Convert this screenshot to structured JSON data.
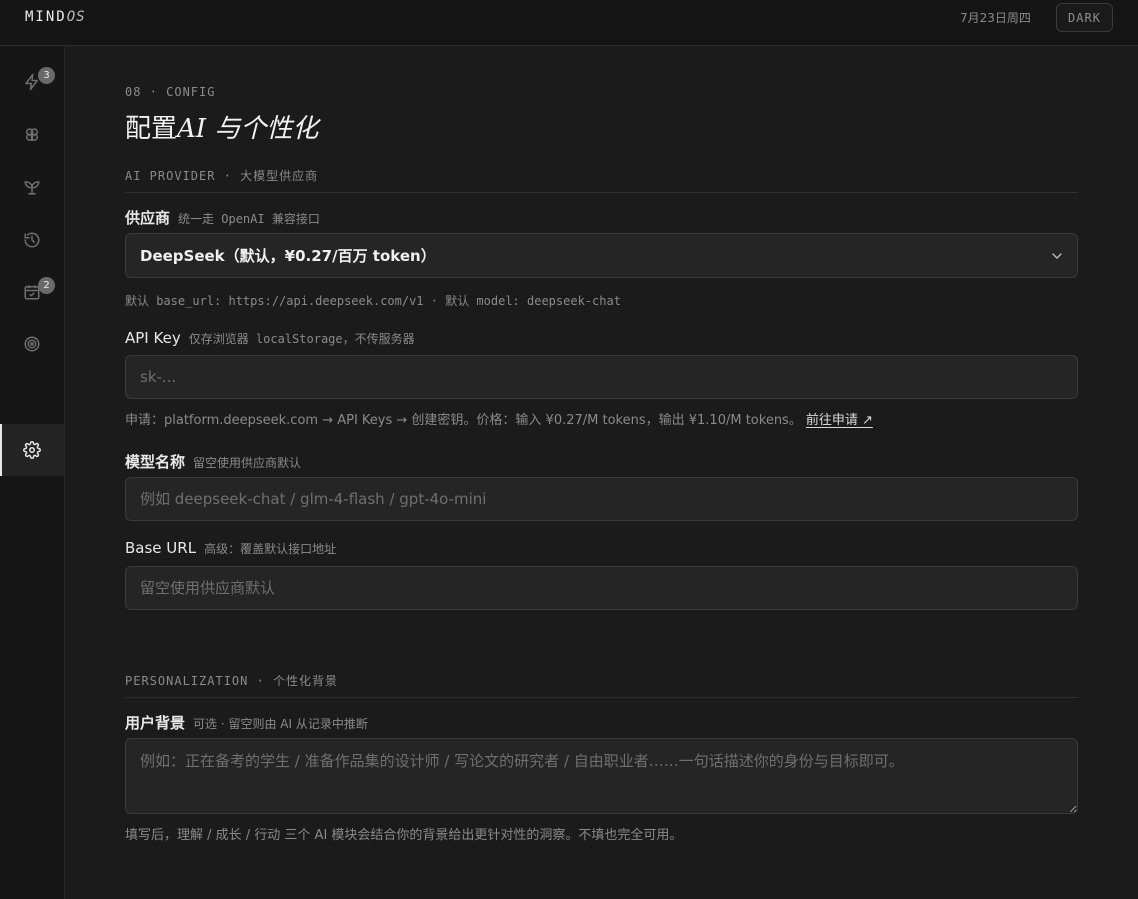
{
  "topbar": {
    "brand_main": "MIND",
    "brand_os": "OS",
    "date": "7月23日周四",
    "theme_label": "DARK"
  },
  "sidebar": {
    "items": [
      {
        "icon": "lightning-icon",
        "badge": "3",
        "active": false
      },
      {
        "icon": "brain-icon",
        "badge": "",
        "active": false
      },
      {
        "icon": "sprout-icon",
        "badge": "",
        "active": false
      },
      {
        "icon": "history-icon",
        "badge": "",
        "active": false
      },
      {
        "icon": "calendar-check-icon",
        "badge": "2",
        "active": false
      },
      {
        "icon": "target-icon",
        "badge": "",
        "active": false
      },
      {
        "icon": "gear-icon",
        "badge": "",
        "active": true
      }
    ]
  },
  "page": {
    "kicker": "08 · CONFIG",
    "title_prefix": "配置",
    "title_ai": "AI",
    "title_suffix": " 与个性化"
  },
  "provider_section": {
    "heading": "AI PROVIDER · 大模型供应商",
    "provider_label": "供应商",
    "provider_hint": "统一走 OpenAI 兼容接口",
    "provider_value": "DeepSeek（默认，¥0.27/百万 token）",
    "provider_help": "默认 base_url: https://api.deepseek.com/v1 · 默认 model: deepseek-chat",
    "apikey_label": "API Key",
    "apikey_hint": "仅存浏览器 localStorage，不传服务器",
    "apikey_placeholder": "sk-...",
    "apikey_help": "申请：platform.deepseek.com → API Keys → 创建密钥。价格：输入 ¥0.27/M tokens，输出 ¥1.10/M tokens。",
    "apikey_link": "前往申请 ↗",
    "model_label": "模型名称",
    "model_hint": "留空使用供应商默认",
    "model_placeholder": "例如 deepseek-chat / glm-4-flash / gpt-4o-mini",
    "baseurl_label": "Base URL",
    "baseurl_hint": "高级：覆盖默认接口地址",
    "baseurl_placeholder": "留空使用供应商默认"
  },
  "personalization_section": {
    "heading": "PERSONALIZATION · 个性化背景",
    "bg_label": "用户背景",
    "bg_hint": "可选 · 留空则由 AI 从记录中推断",
    "bg_placeholder": "例如：正在备考的学生 / 准备作品集的设计师 / 写论文的研究者 / 自由职业者……一句话描述你的身份与目标即可。",
    "bg_help": "填写后，理解 / 成长 / 行动 三个 AI 模块会结合你的背景给出更针对性的洞察。不填也完全可用。"
  }
}
